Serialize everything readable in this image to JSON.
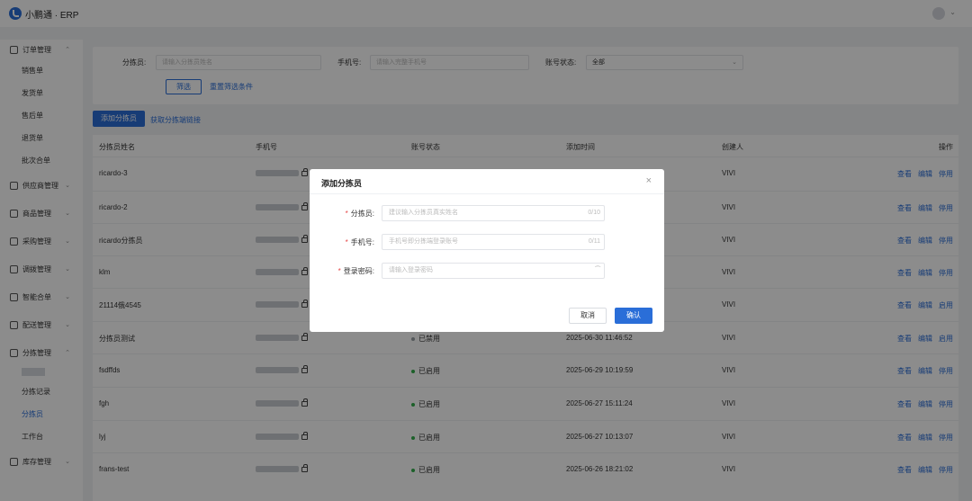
{
  "app": {
    "title": "小鹏通 · ERP"
  },
  "sidebar": {
    "groups": [
      {
        "label": "订单管理",
        "icon": "order-icon",
        "caret": "⌃",
        "children": [
          "销售单",
          "发货单",
          "售后单",
          "退货单",
          "批次合单"
        ]
      },
      {
        "label": "供应商管理",
        "icon": "supplier-icon",
        "caret": "⌄"
      },
      {
        "label": "商品管理",
        "icon": "goods-icon",
        "caret": "⌄"
      },
      {
        "label": "采购管理",
        "icon": "purchase-icon",
        "caret": "⌄"
      },
      {
        "label": "调拨管理",
        "icon": "transfer-icon",
        "caret": "⌄"
      },
      {
        "label": "智能合单",
        "icon": "merge-icon",
        "caret": "⌄"
      },
      {
        "label": "配送管理",
        "icon": "delivery-icon",
        "caret": "⌄"
      },
      {
        "label": "分拣管理",
        "icon": "sorting-icon",
        "caret": "⌃",
        "children": [
          "分拣记录",
          "分拣员",
          "工作台"
        ]
      },
      {
        "label": "库存管理",
        "icon": "inventory-icon",
        "caret": "⌄"
      }
    ]
  },
  "filter": {
    "sorter_label": "分拣员:",
    "sorter_placeholder": "请输入分拣员姓名",
    "phone_label": "手机号:",
    "phone_placeholder": "请输入完整手机号",
    "status_label": "账号状态:",
    "status_value": "全部",
    "filter_button": "筛选",
    "reset_link": "重置筛选条件"
  },
  "actions": {
    "add_button": "添加分拣员",
    "get_link": "获取分拣端链接"
  },
  "table": {
    "columns": [
      "分拣员姓名",
      "手机号",
      "账号状态",
      "添加时间",
      "创建人",
      "操作"
    ],
    "rows": [
      {
        "name": "ricardo-3",
        "status": "",
        "time": "",
        "creator": "VIVI",
        "ops": [
          "查看",
          "编辑",
          "停用"
        ]
      },
      {
        "name": "ricardo-2",
        "status": "",
        "time": "",
        "creator": "VIVI",
        "ops": [
          "查看",
          "编辑",
          "停用"
        ]
      },
      {
        "name": "ricardo分拣员",
        "status": "",
        "time": "",
        "creator": "VIVI",
        "ops": [
          "查看",
          "编辑",
          "停用"
        ]
      },
      {
        "name": "klm",
        "status": "",
        "time": "",
        "creator": "VIVI",
        "ops": [
          "查看",
          "编辑",
          "停用"
        ]
      },
      {
        "name": "21114俄4545",
        "status": "",
        "time": "",
        "creator": "VIVI",
        "ops": [
          "查看",
          "编辑",
          "启用"
        ]
      },
      {
        "name": "分拣员测试",
        "status": "已禁用",
        "time": "2025-06-30 11:46:52",
        "creator": "VIVI",
        "ops": [
          "查看",
          "编辑",
          "启用"
        ]
      },
      {
        "name": "fsdffds",
        "status": "已启用",
        "time": "2025-06-29 10:19:59",
        "creator": "VIVI",
        "ops": [
          "查看",
          "编辑",
          "停用"
        ]
      },
      {
        "name": "fgh",
        "status": "已启用",
        "time": "2025-06-27 15:11:24",
        "creator": "VIVI",
        "ops": [
          "查看",
          "编辑",
          "停用"
        ]
      },
      {
        "name": "lyj",
        "status": "已启用",
        "time": "2025-06-27 10:13:07",
        "creator": "VIVI",
        "ops": [
          "查看",
          "编辑",
          "停用"
        ]
      },
      {
        "name": "frans-test",
        "status": "已启用",
        "time": "2025-06-26 18:21:02",
        "creator": "VIVI",
        "ops": [
          "查看",
          "编辑",
          "停用"
        ]
      }
    ]
  },
  "modal": {
    "title": "添加分拣员",
    "close": "×",
    "fields": [
      {
        "label": "分拣员:",
        "placeholder": "建议输入分拣员真实姓名",
        "count": "0/10"
      },
      {
        "label": "手机号:",
        "placeholder": "手机号即分拣端登录账号",
        "count": "0/11"
      },
      {
        "label": "登录密码:",
        "placeholder": "请输入登录密码",
        "suffix_icon": "eye-off-icon"
      }
    ],
    "cancel": "取消",
    "confirm": "确认"
  },
  "colors": {
    "accent": "#2a6ed8",
    "status_enabled": "#33b04d",
    "required": "#e54545"
  }
}
